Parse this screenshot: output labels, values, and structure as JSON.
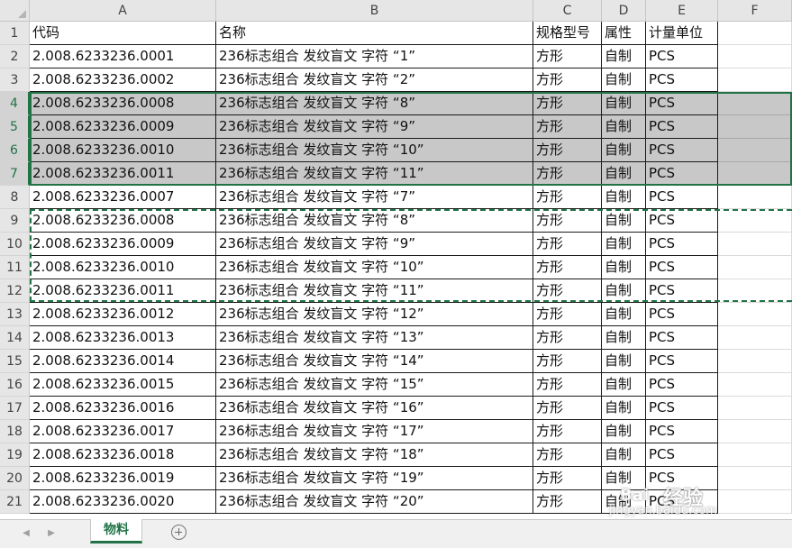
{
  "columns": [
    {
      "letter": "A",
      "width": 207
    },
    {
      "letter": "B",
      "width": 352
    },
    {
      "letter": "C",
      "width": 76
    },
    {
      "letter": "D",
      "width": 49
    },
    {
      "letter": "E",
      "width": 80
    },
    {
      "letter": "F",
      "width": 82
    }
  ],
  "header_row": [
    "代码",
    "名称",
    "规格型号",
    "属性",
    "计量单位"
  ],
  "rows": [
    [
      "2.008.6233236.0001",
      "236标志组合 发纹盲文 字符 “1”",
      "方形",
      "自制",
      "PCS"
    ],
    [
      "2.008.6233236.0002",
      "236标志组合 发纹盲文 字符 “2”",
      "方形",
      "自制",
      "PCS"
    ],
    [
      "2.008.6233236.0008",
      "236标志组合 发纹盲文 字符 “8”",
      "方形",
      "自制",
      "PCS"
    ],
    [
      "2.008.6233236.0009",
      "236标志组合 发纹盲文 字符 “9”",
      "方形",
      "自制",
      "PCS"
    ],
    [
      "2.008.6233236.0010",
      "236标志组合 发纹盲文 字符 “10”",
      "方形",
      "自制",
      "PCS"
    ],
    [
      "2.008.6233236.0011",
      "236标志组合 发纹盲文 字符 “11”",
      "方形",
      "自制",
      "PCS"
    ],
    [
      "2.008.6233236.0007",
      "236标志组合 发纹盲文 字符 “7”",
      "方形",
      "自制",
      "PCS"
    ],
    [
      "2.008.6233236.0008",
      "236标志组合 发纹盲文 字符 “8”",
      "方形",
      "自制",
      "PCS"
    ],
    [
      "2.008.6233236.0009",
      "236标志组合 发纹盲文 字符 “9”",
      "方形",
      "自制",
      "PCS"
    ],
    [
      "2.008.6233236.0010",
      "236标志组合 发纹盲文 字符 “10”",
      "方形",
      "自制",
      "PCS"
    ],
    [
      "2.008.6233236.0011",
      "236标志组合 发纹盲文 字符 “11”",
      "方形",
      "自制",
      "PCS"
    ],
    [
      "2.008.6233236.0012",
      "236标志组合 发纹盲文 字符 “12”",
      "方形",
      "自制",
      "PCS"
    ],
    [
      "2.008.6233236.0013",
      "236标志组合 发纹盲文 字符 “13”",
      "方形",
      "自制",
      "PCS"
    ],
    [
      "2.008.6233236.0014",
      "236标志组合 发纹盲文 字符 “14”",
      "方形",
      "自制",
      "PCS"
    ],
    [
      "2.008.6233236.0015",
      "236标志组合 发纹盲文 字符 “15”",
      "方形",
      "自制",
      "PCS"
    ],
    [
      "2.008.6233236.0016",
      "236标志组合 发纹盲文 字符 “16”",
      "方形",
      "自制",
      "PCS"
    ],
    [
      "2.008.6233236.0017",
      "236标志组合 发纹盲文 字符 “17”",
      "方形",
      "自制",
      "PCS"
    ],
    [
      "2.008.6233236.0018",
      "236标志组合 发纹盲文 字符 “18”",
      "方形",
      "自制",
      "PCS"
    ],
    [
      "2.008.6233236.0019",
      "236标志组合 发纹盲文 字符 “19”",
      "方形",
      "自制",
      "PCS"
    ],
    [
      "2.008.6233236.0020",
      "236标志组合 发纹盲文 字符 “20”",
      "方形",
      "自制",
      "PCS"
    ]
  ],
  "selected_rows": [
    4,
    5,
    6,
    7
  ],
  "sheet_tab": "物料",
  "watermark": {
    "text": "经验",
    "url": "jingyan.baidu.com",
    "brand": "Bai"
  },
  "colors": {
    "accent": "#217346",
    "selection_fill": "#c8c8c8"
  }
}
